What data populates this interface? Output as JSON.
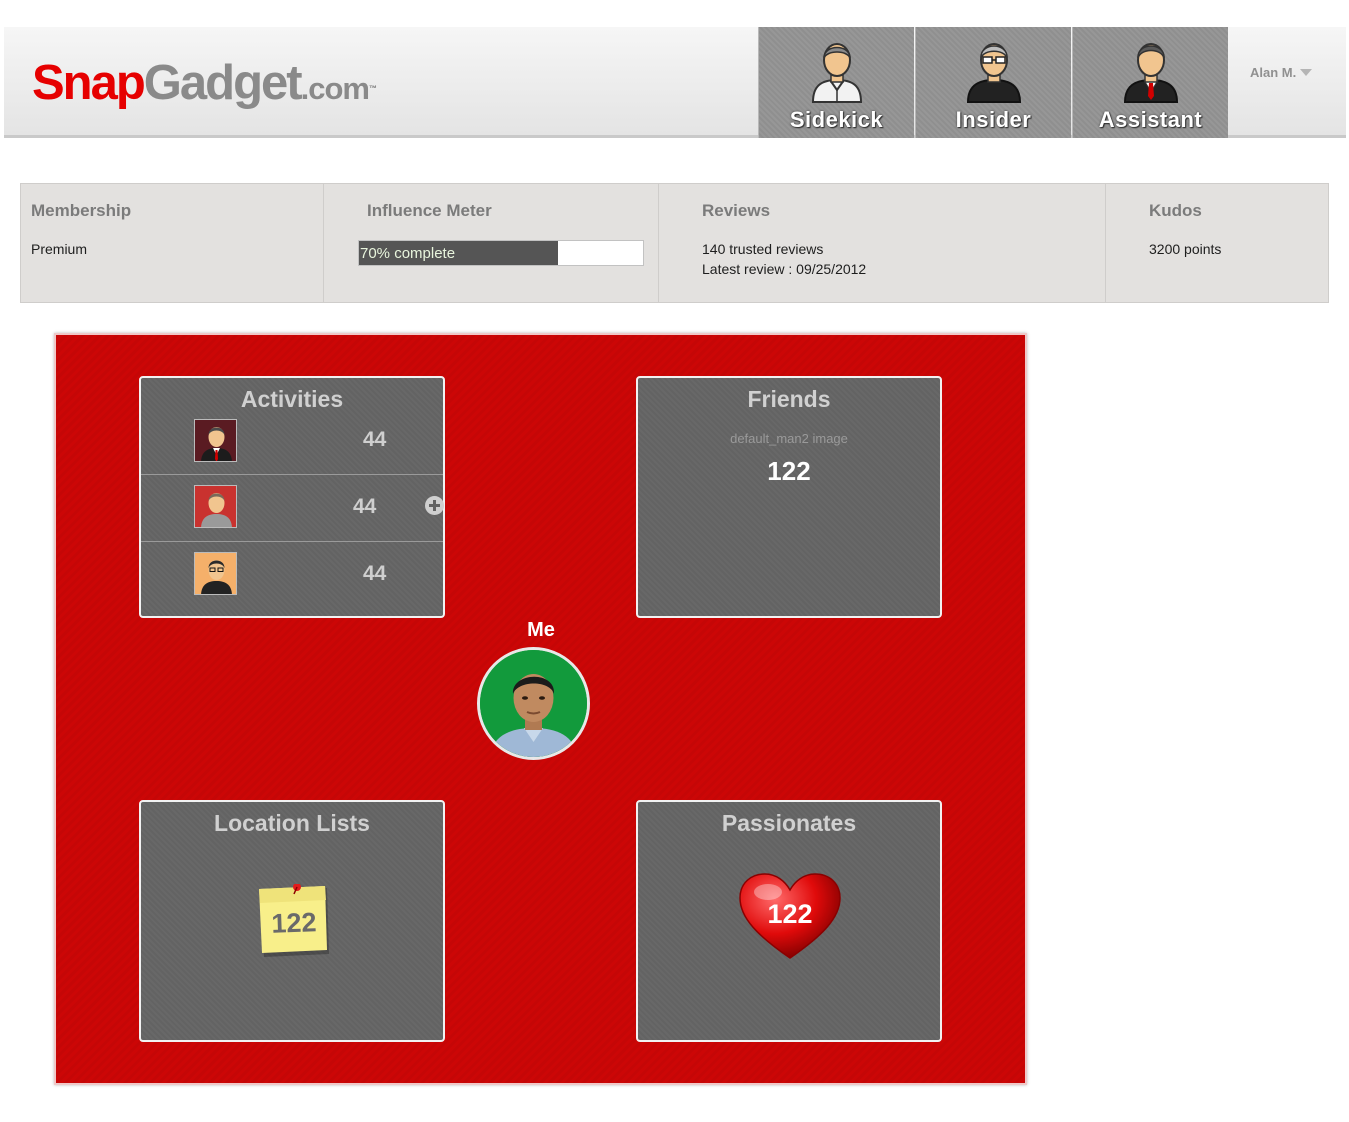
{
  "header": {
    "logo": {
      "part1": "Snap",
      "part2": "Gadget",
      "part3": ".com",
      "tm": "™"
    },
    "roles": [
      {
        "label": "Sidekick",
        "icon": "sidekick-avatar-icon"
      },
      {
        "label": "Insider",
        "icon": "insider-avatar-icon"
      },
      {
        "label": "Assistant",
        "icon": "assistant-avatar-icon"
      }
    ],
    "user": {
      "name": "Alan M.",
      "icon": "caret-down-icon"
    }
  },
  "stats": {
    "membership": {
      "title": "Membership",
      "value": "Premium"
    },
    "influence": {
      "title": "Influence Meter",
      "progress_percent": 70,
      "progress_text": "70% complete"
    },
    "reviews": {
      "title": "Reviews",
      "count_text": "140 trusted reviews",
      "latest_text": "Latest review : 09/25/2012"
    },
    "kudos": {
      "title": "Kudos",
      "value": "3200 points"
    }
  },
  "board": {
    "activities": {
      "title": "Activities",
      "rows": [
        {
          "count": "44",
          "icon": "businessman-icon"
        },
        {
          "count": "44",
          "icon": "casual-man-icon"
        },
        {
          "count": "44",
          "icon": "glasses-man-icon"
        }
      ],
      "add_icon": "plus-circle-icon"
    },
    "friends": {
      "title": "Friends",
      "image_alt": "default_man2 image",
      "count": "122"
    },
    "me": {
      "label": "Me"
    },
    "location_lists": {
      "title": "Location Lists",
      "count": "122",
      "icon": "sticky-note-icon"
    },
    "passionates": {
      "title": "Passionates",
      "count": "122",
      "icon": "heart-icon"
    }
  },
  "colors": {
    "brand_red": "#e60000",
    "board_red": "#cc0606",
    "panel_gray": "#636363",
    "tab_gray": "#8f8f8f",
    "progress_fill": "#555555"
  }
}
